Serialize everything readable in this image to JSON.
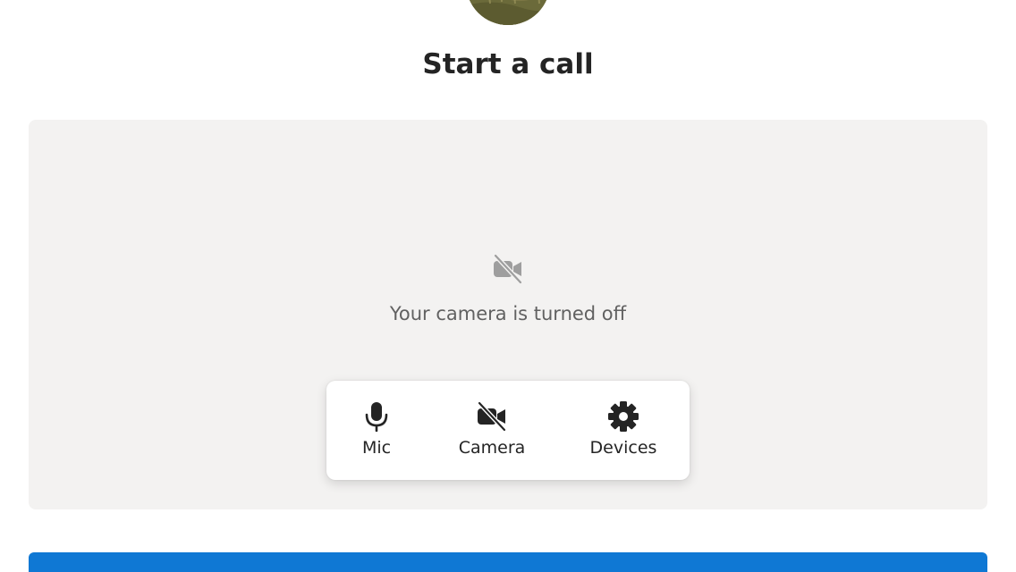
{
  "header": {
    "avatar_icon": "user-avatar",
    "title": "Start a call"
  },
  "preview": {
    "camera_off_icon": "video-off-icon",
    "camera_off_text": "Your camera is turned off"
  },
  "controls": [
    {
      "id": "mic",
      "label": "Mic",
      "icon": "microphone-icon"
    },
    {
      "id": "camera",
      "label": "Camera",
      "icon": "video-off-icon"
    },
    {
      "id": "devices",
      "label": "Devices",
      "icon": "gear-icon"
    }
  ],
  "colors": {
    "accent": "#0f78d4",
    "preview_bg": "#f3f2f1",
    "text_primary": "#242424",
    "text_secondary": "#616161",
    "icon_muted": "#9e9e9e"
  }
}
